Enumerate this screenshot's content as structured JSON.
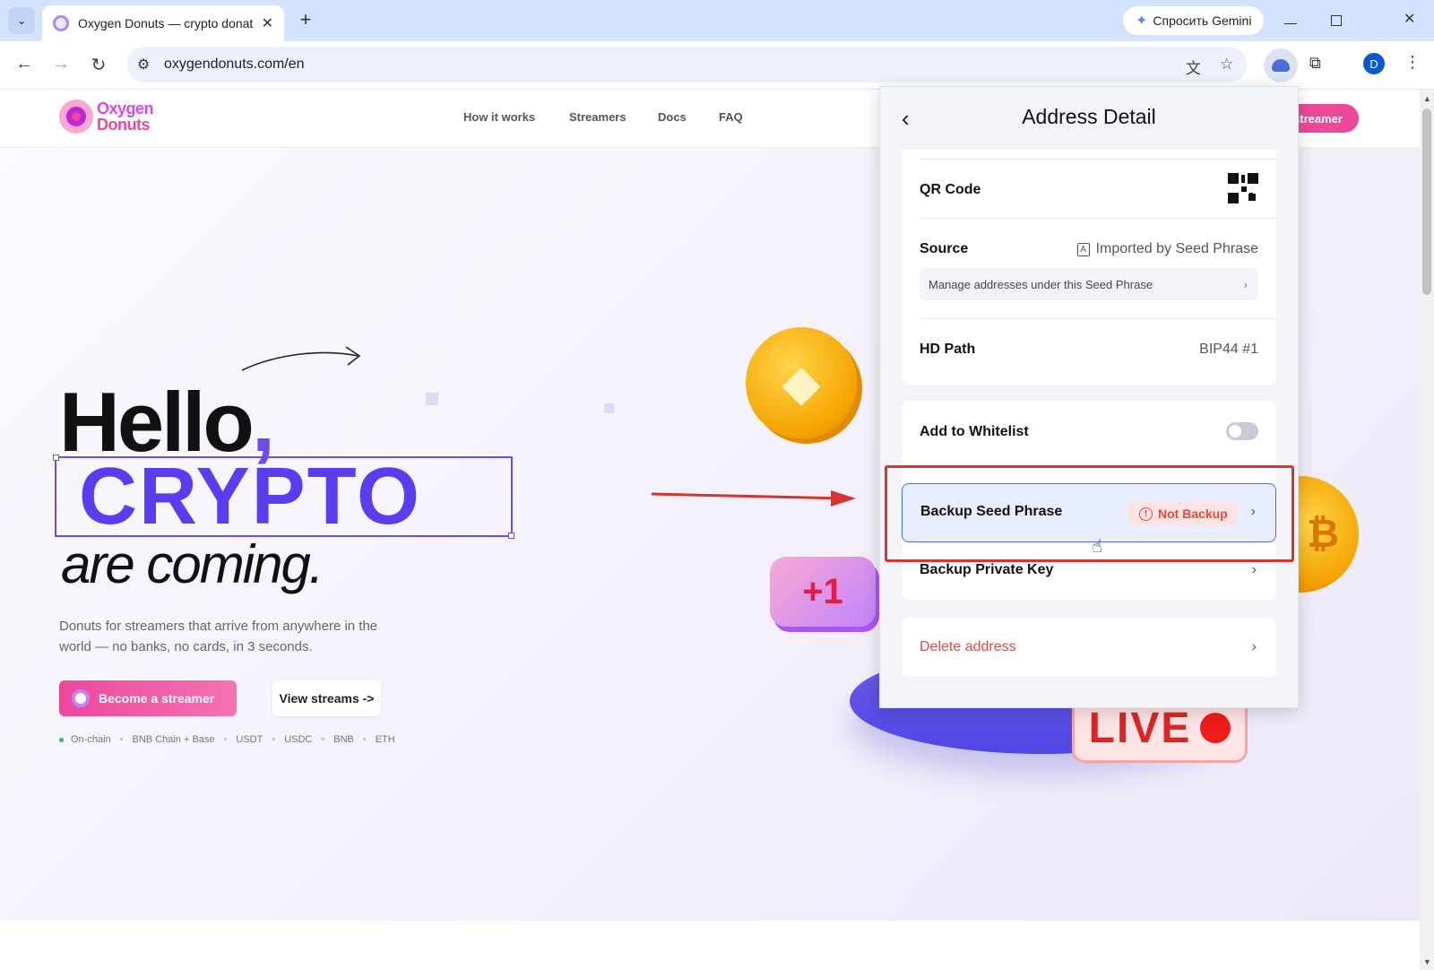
{
  "browser": {
    "tab_title": "Oxygen Donuts — crypto donat",
    "url": "oxygendonuts.com/en",
    "gemini_label": "Спросить Gemini",
    "avatar_letter": "D"
  },
  "site": {
    "logo_line1": "Oxygen",
    "logo_line2": "Donuts",
    "nav": [
      "How it works",
      "Streamers",
      "Docs",
      "FAQ"
    ],
    "header_cta": "streamer",
    "hero_hello": "Hello",
    "hero_comma": ",",
    "hero_crypto": "CRYPTO",
    "hero_coming": "are coming.",
    "hero_sub": "Donuts for streamers that arrive from anywhere in the world — no banks, no cards, in 3 seconds.",
    "btn_become": "Become a streamer",
    "btn_view": "View streams ->",
    "chips": [
      "On-chain",
      "BNB Chain + Base",
      "USDT",
      "USDC",
      "BNB",
      "ETH"
    ],
    "plus_one": "+1",
    "live": "LIVE"
  },
  "popup": {
    "title": "Address Detail",
    "qr_label": "QR Code",
    "source_label": "Source",
    "source_icon": "A",
    "source_value": "Imported by Seed Phrase",
    "source_manage": "Manage addresses under this Seed Phrase",
    "hd_label": "HD Path",
    "hd_value": "BIP44 #1",
    "whitelist_label": "Add to Whitelist",
    "whitelist_on": false,
    "backup_seed_label": "Backup Seed Phrase",
    "backup_seed_badge": "Not Backup",
    "backup_key_label": "Backup Private Key",
    "delete_label": "Delete address"
  },
  "colors": {
    "accent_purple": "#5b3df0",
    "brand_pink": "#ec4899",
    "danger_red": "#e5483f",
    "highlight_red": "#d9332f"
  }
}
